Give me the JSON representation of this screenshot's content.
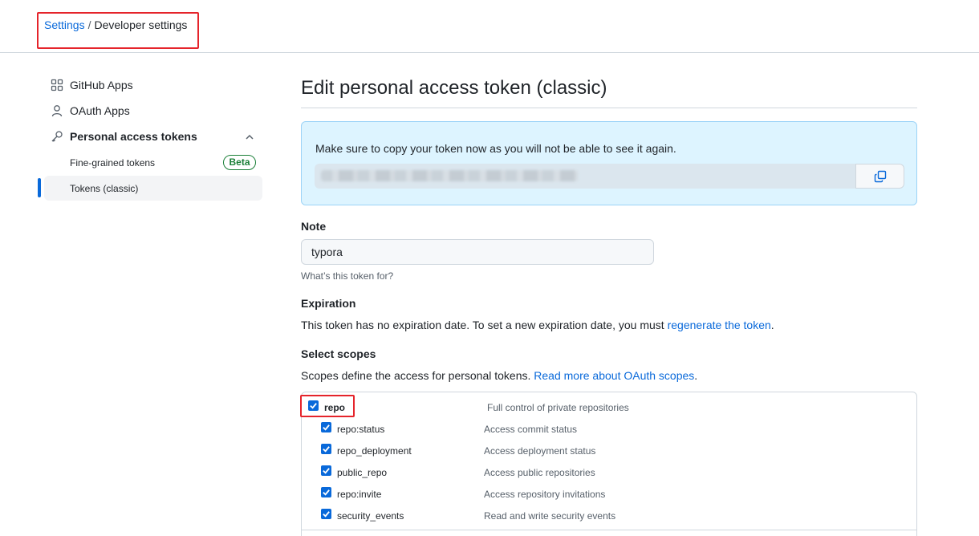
{
  "breadcrumb": {
    "root": "Settings",
    "separator": "/",
    "current": "Developer settings"
  },
  "sidebar": {
    "items": [
      {
        "label": "GitHub Apps",
        "icon": "apps-icon"
      },
      {
        "label": "OAuth Apps",
        "icon": "person-icon"
      },
      {
        "label": "Personal access tokens",
        "icon": "key-icon"
      }
    ],
    "sub_items": [
      {
        "label": "Fine-grained tokens",
        "badge": "Beta"
      },
      {
        "label": "Tokens (classic)",
        "active": true
      }
    ]
  },
  "main": {
    "title": "Edit personal access token (classic)",
    "flash": {
      "message": "Make sure to copy your token now as you will not be able to see it again."
    },
    "note": {
      "label": "Note",
      "value": "typora",
      "hint": "What’s this token for?"
    },
    "expiration": {
      "label": "Expiration",
      "text": "This token has no expiration date. To set a new expiration date, you must ",
      "link": "regenerate the token",
      "end": "."
    },
    "scopes": {
      "label": "Select scopes",
      "text": "Scopes define the access for personal tokens. ",
      "link": "Read more about OAuth scopes",
      "end": ".",
      "items": [
        {
          "name": "repo",
          "desc": "Full control of private repositories",
          "checked": true
        },
        {
          "name": "repo:status",
          "desc": "Access commit status",
          "checked": true
        },
        {
          "name": "repo_deployment",
          "desc": "Access deployment status",
          "checked": true
        },
        {
          "name": "public_repo",
          "desc": "Access public repositories",
          "checked": true
        },
        {
          "name": "repo:invite",
          "desc": "Access repository invitations",
          "checked": true
        },
        {
          "name": "security_events",
          "desc": "Read and write security events",
          "checked": true
        }
      ]
    }
  },
  "colors": {
    "accent": "#0969da",
    "highlight": "#e5242b",
    "flash_bg": "#ddf4ff",
    "beta_green": "#1a7f37"
  }
}
